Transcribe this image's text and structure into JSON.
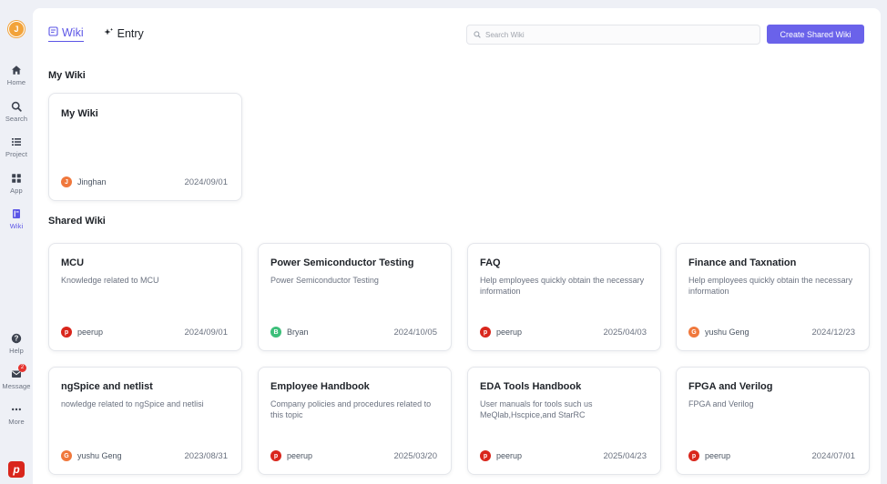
{
  "user": {
    "initial": "J"
  },
  "rail": {
    "nav": [
      {
        "id": "home",
        "label": "Home",
        "icon": "home-icon"
      },
      {
        "id": "search",
        "label": "Search",
        "icon": "search-icon"
      },
      {
        "id": "project",
        "label": "Project",
        "icon": "list-icon"
      },
      {
        "id": "app",
        "label": "App",
        "icon": "grid-icon"
      },
      {
        "id": "wiki",
        "label": "Wiki",
        "icon": "book-icon",
        "active": true
      }
    ],
    "bottom": [
      {
        "id": "help",
        "label": "Help",
        "icon": "help-icon"
      },
      {
        "id": "message",
        "label": "Message",
        "icon": "mail-icon",
        "badge": "2"
      },
      {
        "id": "more",
        "label": "More",
        "icon": "more-icon"
      }
    ],
    "brand": "p"
  },
  "tabs": [
    {
      "label": "Wiki",
      "icon": "document-icon",
      "active": true
    },
    {
      "label": "Entry",
      "icon": "sparkle-icon",
      "active": false
    }
  ],
  "search": {
    "placeholder": "Search Wiki",
    "value": ""
  },
  "create_button": "Create Shared Wiki",
  "my_wiki": {
    "heading": "My Wiki",
    "cards": [
      {
        "title": "My Wiki",
        "desc": "",
        "author": "Jinghan",
        "avatar": "J",
        "avatar_color": "#f0783c",
        "date": "2024/09/01"
      }
    ]
  },
  "shared_wiki": {
    "heading": "Shared Wiki",
    "cards": [
      {
        "title": "MCU",
        "desc": "Knowledge related to MCU",
        "author": "peerup",
        "avatar": "p",
        "avatar_color": "#d9261c",
        "date": "2024/09/01"
      },
      {
        "title": "Power Semiconductor Testing",
        "desc": "Power Semiconductor Testing",
        "author": "Bryan",
        "avatar": "B",
        "avatar_color": "#3cbf7a",
        "date": "2024/10/05"
      },
      {
        "title": "FAQ",
        "desc": "Help employees quickly obtain the necessary information",
        "author": "peerup",
        "avatar": "p",
        "avatar_color": "#d9261c",
        "date": "2025/04/03"
      },
      {
        "title": "Finance and Taxnation",
        "desc": "Help employees quickly obtain the necessary information",
        "author": "yushu Geng",
        "avatar": "G",
        "avatar_color": "#f0783c",
        "date": "2024/12/23"
      },
      {
        "title": "ngSpice and netlist",
        "desc": "nowledge related to ngSpice and netlisi",
        "author": "yushu Geng",
        "avatar": "G",
        "avatar_color": "#f0783c",
        "date": "2023/08/31"
      },
      {
        "title": "Employee Handbook",
        "desc": "Company policies and procedures related to this topic",
        "author": "peerup",
        "avatar": "p",
        "avatar_color": "#d9261c",
        "date": "2025/03/20"
      },
      {
        "title": "EDA Tools Handbook",
        "desc": "User manuals for tools such us MeQlab,Hscpice,and StarRC",
        "author": "peerup",
        "avatar": "p",
        "avatar_color": "#d9261c",
        "date": "2025/04/23"
      },
      {
        "title": "FPGA and Verilog",
        "desc": "FPGA and Verilog",
        "author": "peerup",
        "avatar": "p",
        "avatar_color": "#d9261c",
        "date": "2024/07/01"
      }
    ]
  }
}
